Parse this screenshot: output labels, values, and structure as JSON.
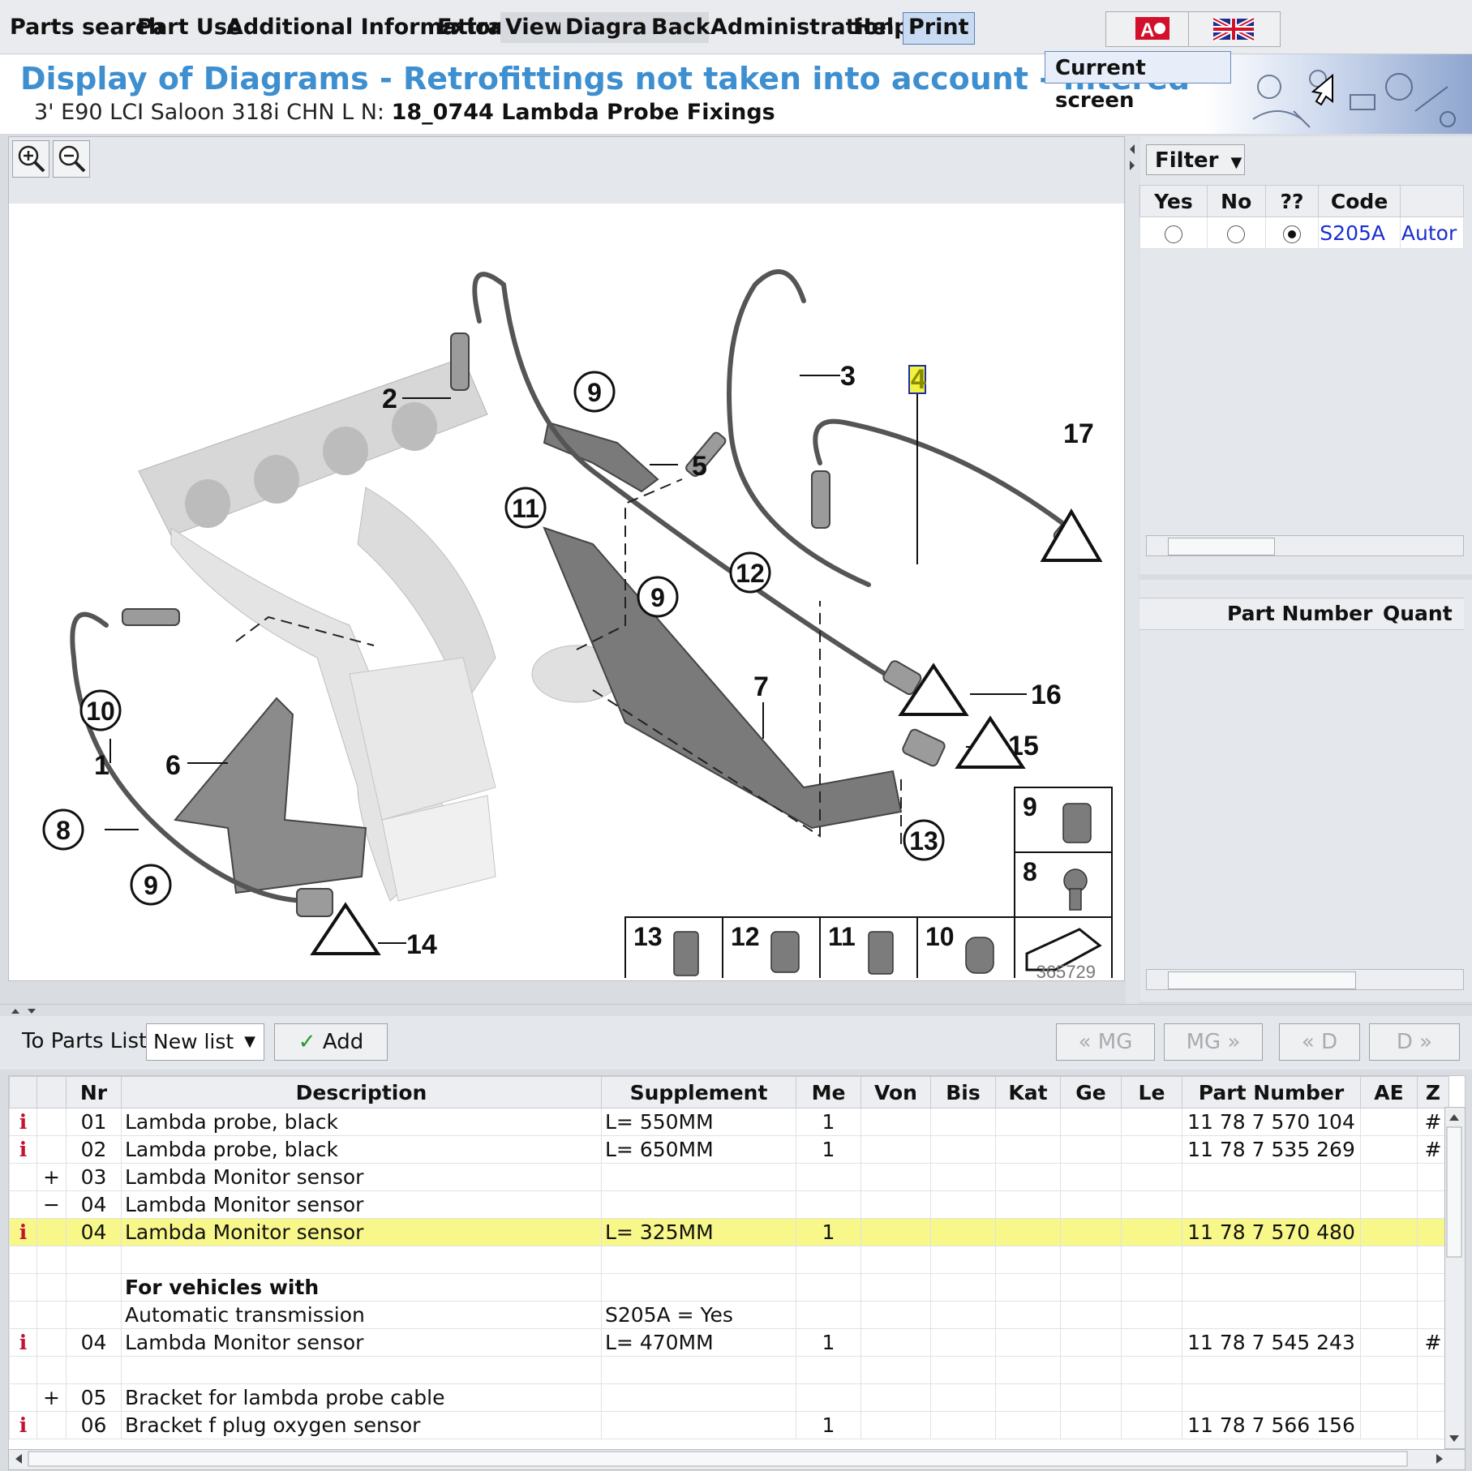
{
  "menu": [
    "Parts search",
    "Part Use",
    "Additional Information",
    "Extras",
    "View",
    "Diagram",
    "Back",
    "Administration",
    "Help",
    "Print"
  ],
  "print_dropdown": "Current screen",
  "header": {
    "title": "Display of Diagrams - Retrofittings not taken into account - filtered",
    "vehicle": "3' E90 LCI Saloon 318i CHN  L N:",
    "diagram_name": "18_0744 Lambda Probe Fixings"
  },
  "diagram": {
    "image_number": "365729",
    "callouts": [
      "1",
      "2",
      "3",
      "4",
      "5",
      "6",
      "7",
      "8",
      "9",
      "10",
      "11",
      "12",
      "13",
      "14",
      "15",
      "16",
      "17"
    ]
  },
  "filter": {
    "button": "Filter",
    "columns": [
      "Yes",
      "No",
      "??",
      "Code"
    ],
    "rows": [
      {
        "yes": false,
        "no": false,
        "unknown": true,
        "code": "S205A",
        "extra": "Autor"
      }
    ]
  },
  "parts_panel": {
    "columns": [
      "Part Number",
      "Quant"
    ]
  },
  "toolbar": {
    "to_parts_list": "To Parts List",
    "list_select": "New list",
    "add": "Add",
    "nav": [
      "« MG",
      "MG »",
      "« D",
      "D »"
    ]
  },
  "grid": {
    "columns": [
      "",
      "",
      "Nr",
      "Description",
      "Supplement",
      "Me",
      "Von",
      "Bis",
      "Kat",
      "Ge",
      "Le",
      "Part Number",
      "AE",
      "Z"
    ],
    "rows": [
      {
        "info": "i",
        "tree": "",
        "nr": "01",
        "desc": "Lambda probe, black",
        "supp": "L= 550MM",
        "me": "1",
        "pn": "11 78 7 570 104",
        "z": "#"
      },
      {
        "info": "i",
        "tree": "",
        "nr": "02",
        "desc": "Lambda probe, black",
        "supp": "L= 650MM",
        "me": "1",
        "pn": "11 78 7 535 269",
        "z": "#"
      },
      {
        "info": "",
        "tree": "+",
        "nr": "03",
        "desc": "Lambda Monitor sensor",
        "supp": "",
        "me": "",
        "pn": "",
        "z": ""
      },
      {
        "info": "",
        "tree": "−",
        "nr": "04",
        "desc": "Lambda Monitor sensor",
        "supp": "",
        "me": "",
        "pn": "",
        "z": ""
      },
      {
        "info": "i",
        "tree": "",
        "nr": "04",
        "desc": "Lambda Monitor sensor",
        "supp": "L= 325MM",
        "me": "1",
        "pn": "11 78 7 570 480",
        "z": "",
        "selected": true
      },
      {
        "info": "",
        "tree": "",
        "nr": "",
        "desc": "",
        "supp": "",
        "me": "",
        "pn": "",
        "z": ""
      },
      {
        "info": "",
        "tree": "",
        "nr": "",
        "desc": "For vehicles with",
        "supp": "",
        "me": "",
        "pn": "",
        "z": "",
        "bold": true
      },
      {
        "info": "",
        "tree": "",
        "nr": "",
        "desc": "Automatic transmission",
        "supp": "S205A = Yes",
        "me": "",
        "pn": "",
        "z": ""
      },
      {
        "info": "i",
        "tree": "",
        "nr": "04",
        "desc": "Lambda Monitor sensor",
        "supp": "L= 470MM",
        "me": "1",
        "pn": "11 78 7 545 243",
        "z": "#"
      },
      {
        "info": "",
        "tree": "",
        "nr": "",
        "desc": "",
        "supp": "",
        "me": "",
        "pn": "",
        "z": ""
      },
      {
        "info": "",
        "tree": "+",
        "nr": "05",
        "desc": "Bracket for lambda probe cable",
        "supp": "",
        "me": "",
        "pn": "",
        "z": ""
      },
      {
        "info": "i",
        "tree": "",
        "nr": "06",
        "desc": "Bracket f plug oxygen sensor",
        "supp": "",
        "me": "1",
        "pn": "11 78 7 566 156",
        "z": ""
      }
    ]
  }
}
